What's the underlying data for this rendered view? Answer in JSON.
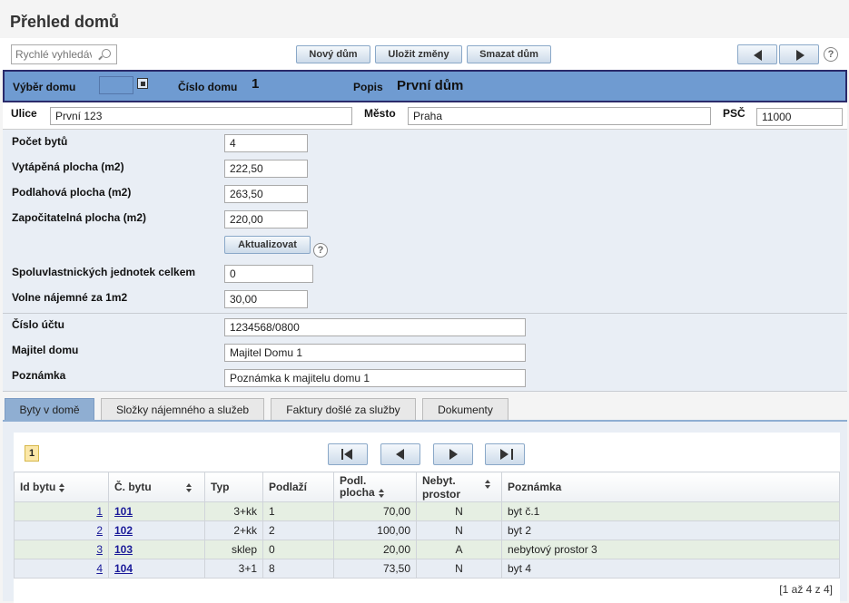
{
  "page": {
    "title": "Přehled domů"
  },
  "toolbar": {
    "search_placeholder": "Rychlé vyhledáv",
    "new_label": "Nový dům",
    "save_label": "Uložit změny",
    "delete_label": "Smazat dům"
  },
  "house": {
    "select_label": "Výběr domu",
    "number_label": "Číslo domu",
    "number_value": "1",
    "description_label": "Popis",
    "description_value": "První dům"
  },
  "address": {
    "street_label": "Ulice",
    "street_value": "První 123",
    "city_label": "Město",
    "city_value": "Praha",
    "zip_label": "PSČ",
    "zip_value": "11000"
  },
  "stats": {
    "flats_label": "Počet bytů",
    "flats_value": "4",
    "heated_label": "Vytápěná plocha (m2)",
    "heated_value": "222,50",
    "floor_label": "Podlahová plocha (m2)",
    "floor_value": "263,50",
    "counted_label": "Započitatelná plocha (m2)",
    "counted_value": "220,00",
    "update_label": "Aktualizovat",
    "units_label": "Spoluvlastnických jednotek celkem",
    "units_value": "0",
    "rent_label": "Volne nájemné za 1m2",
    "rent_value": "30,00"
  },
  "owner": {
    "account_label": "Číslo účtu",
    "account_value": "1234568/0800",
    "owner_label": "Majitel domu",
    "owner_value": "Majitel Domu 1",
    "note_label": "Poznámka",
    "note_value": "Poznámka k majitelu domu 1"
  },
  "tabs": [
    "Byty v domě",
    "Složky nájemného a služeb",
    "Faktury došlé za služby",
    "Dokumenty"
  ],
  "grid": {
    "page_number": "1",
    "headers": {
      "id": "Id bytu",
      "num": "Č. bytu",
      "type": "Typ",
      "floor": "Podlaží",
      "area_line1": "Podl.",
      "area_line2": "plocha",
      "nonres_line1": "Nebyt.",
      "nonres_line2": "prostor",
      "note": "Poznámka"
    },
    "rows": [
      {
        "id": "1",
        "num": "101",
        "type": "3+kk",
        "floor": "1",
        "area": "70,00",
        "nonres": "N",
        "note": "byt č.1"
      },
      {
        "id": "2",
        "num": "102",
        "type": "2+kk",
        "floor": "2",
        "area": "100,00",
        "nonres": "N",
        "note": "byt 2"
      },
      {
        "id": "3",
        "num": "103",
        "type": "sklep",
        "floor": "0",
        "area": "20,00",
        "nonres": "A",
        "note": "nebytový prostor 3"
      },
      {
        "id": "4",
        "num": "104",
        "type": "3+1",
        "floor": "8",
        "area": "73,50",
        "nonres": "N",
        "note": "byt 4"
      }
    ],
    "count_text": "[1 až 4 z 4]"
  }
}
